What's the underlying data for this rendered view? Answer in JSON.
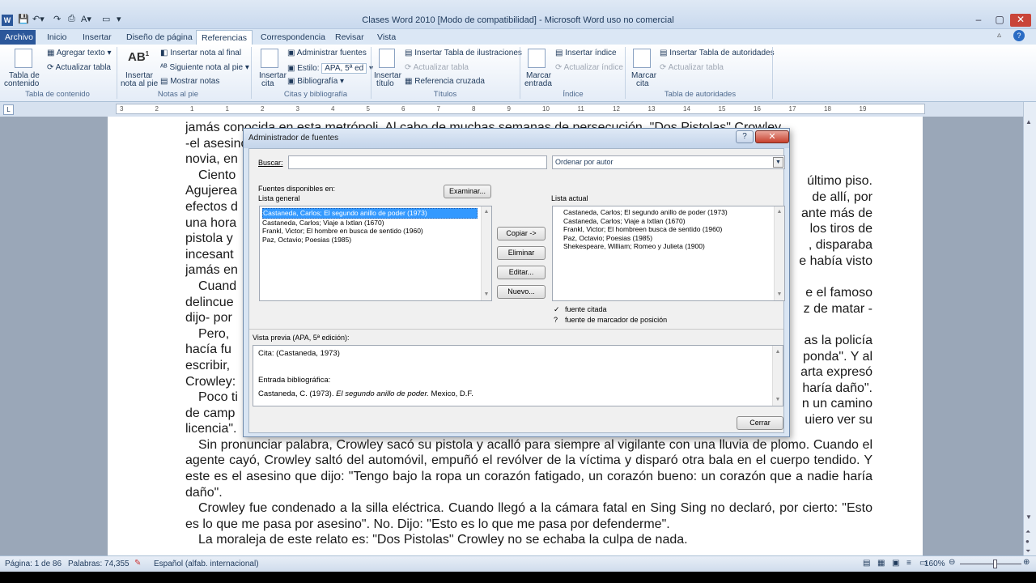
{
  "window": {
    "title": "Clases Word 2010 [Modo de compatibilidad] - Microsoft Word uso no comercial"
  },
  "tabs": [
    "Archivo",
    "Inicio",
    "Insertar",
    "Diseño de página",
    "Referencias",
    "Correspondencia",
    "Revisar",
    "Vista"
  ],
  "ribbon": {
    "tabla_contenido": {
      "label1": "Tabla de",
      "label2": "contenido",
      "group": "Tabla de contenido",
      "agregar": "Agregar texto",
      "actualizar": "Actualizar tabla"
    },
    "notas": {
      "insertar1": "Insertar",
      "insertar2": "nota al pie",
      "nota_final": "Insertar nota al final",
      "siguiente": "Siguiente nota al pie",
      "mostrar": "Mostrar notas",
      "group": "Notas al pie"
    },
    "citas": {
      "insertar1": "Insertar",
      "insertar2": "cita",
      "admin": "Administrar fuentes",
      "estilo_label": "Estilo:",
      "estilo_value": "APA, 5ª ed",
      "bibliografia": "Bibliografía",
      "group": "Citas y bibliografía"
    },
    "titulos": {
      "insertar1": "Insertar",
      "insertar2": "título",
      "tabla_ilus": "Insertar Tabla de ilustraciones",
      "actualizar": "Actualizar tabla",
      "referencia": "Referencia cruzada",
      "group": "Títulos"
    },
    "indice": {
      "marcar1": "Marcar",
      "marcar2": "entrada",
      "insertar": "Insertar índice",
      "actualizar": "Actualizar índice",
      "group": "Índice"
    },
    "autoridades": {
      "marcar1": "Marcar",
      "marcar2": "cita",
      "insertar": "Insertar Tabla de autoridades",
      "actualizar": "Actualizar tabla",
      "group": "Tabla de autoridades"
    }
  },
  "ruler": [
    "3",
    "2",
    "1",
    "1",
    "2",
    "3",
    "4",
    "5",
    "6",
    "7",
    "8",
    "9",
    "10",
    "11",
    "12",
    "13",
    "14",
    "15",
    "16",
    "17",
    "18",
    "19"
  ],
  "document": {
    "lines": [
      "jamás conocida en esta metrópoli. Al cabo de muchas semanas de persecución, \"Dos Pistolas\" Crowley",
      "-el asesino que no bebía ni fumaba- se vio sorprendido, atrapado en el departamento de su",
      "novia, en",
      "Ciento",
      "Agujerea",
      "efectos d",
      "una hora",
      "pistola y",
      "incesant",
      "jamás en",
      "Cuand",
      "delincue",
      "dijo- por",
      "Pero, ",
      "hacía fu",
      "escribir,",
      "Crowley:",
      "Poco ti",
      "de camp",
      "licencia\"."
    ],
    "right_fragments": [
      "último piso.",
      "de allí, por",
      "ante más de",
      "los tiros de",
      ", disparaba",
      "e había visto",
      "e el famoso",
      "z de matar -",
      "as la policía",
      "ponda\". Y al",
      "arta expresó",
      "haría daño\".",
      "n un camino",
      "uiero ver su"
    ],
    "full_lines": [
      "Sin pronunciar palabra, Crowley sacó su pistola y acalló para siempre al vigilante con una lluvia de plomo. Cuando el agente cayó, Crowley saltó del automóvil, empuñó el revólver de la víctima y disparó otra bala en el cuerpo tendido. Y este es el asesino que dijo: \"Tengo bajo la ropa un corazón fatigado, un corazón bueno: un corazón que a nadie haría daño\".",
      "Crowley fue condenado a la silla eléctrica. Cuando llegó a la cámara fatal en Sing Sing no declaró, por cierto: \"Esto es lo que me pasa por asesino\". No. Dijo: \"Esto es lo que me pasa por defenderme\".",
      "La moraleja de este relato es: \"Dos Pistolas\" Crowley no se echaba la culpa de nada."
    ]
  },
  "dialog": {
    "title": "Administrador de fuentes",
    "help": "?",
    "close": "✕",
    "buscar_label": "Buscar:",
    "buscar_value": "",
    "ordenar": "Ordenar por autor",
    "disponibles": "Fuentes disponibles en:",
    "lista_general": "Lista general",
    "examinar": "Examinar...",
    "lista_actual": "Lista actual",
    "general_items": [
      "Castaneda, Carlos; El segundo anillo de poder (1973)",
      "Castaneda, Carlos; Viaje a Ixtlan (1670)",
      "Frankl, Victor; El hombre en busca de sentido (1960)",
      "Paz, Octavio; Poesias (1985)"
    ],
    "actual_items": [
      "Castaneda, Carlos; El segundo anillo de poder (1973)",
      "Castaneda, Carlos; Viaje a Ixtlan (1670)",
      "Frankl, Victor; El hombreen busca de sentido (1960)",
      "Paz, Octavio; Poesias (1985)",
      "Shekespeare, William; Romeo y Julieta (1900)"
    ],
    "copiar": "Copiar ->",
    "eliminar": "Eliminar",
    "editar": "Editar...",
    "nuevo": "Nuevo...",
    "legend_citada": "fuente citada",
    "legend_marcador": "fuente de marcador de posición",
    "check": "✓",
    "question": "?",
    "vista_previa": "Vista previa (APA, 5ª edición):",
    "preview_cita": "Cita:  (Castaneda, 1973)",
    "preview_entrada": "Entrada bibliográfica:",
    "preview_ref_a": "Castaneda, C. (1973). ",
    "preview_ref_b": "El segundo anillo de poder.",
    "preview_ref_c": " Mexico, D.F.",
    "cerrar": "Cerrar"
  },
  "status": {
    "pagina": "Página: 1 de 86",
    "palabras": "Palabras: 74,355",
    "idioma": "Español (alfab. internacional)",
    "zoom": "160%"
  }
}
